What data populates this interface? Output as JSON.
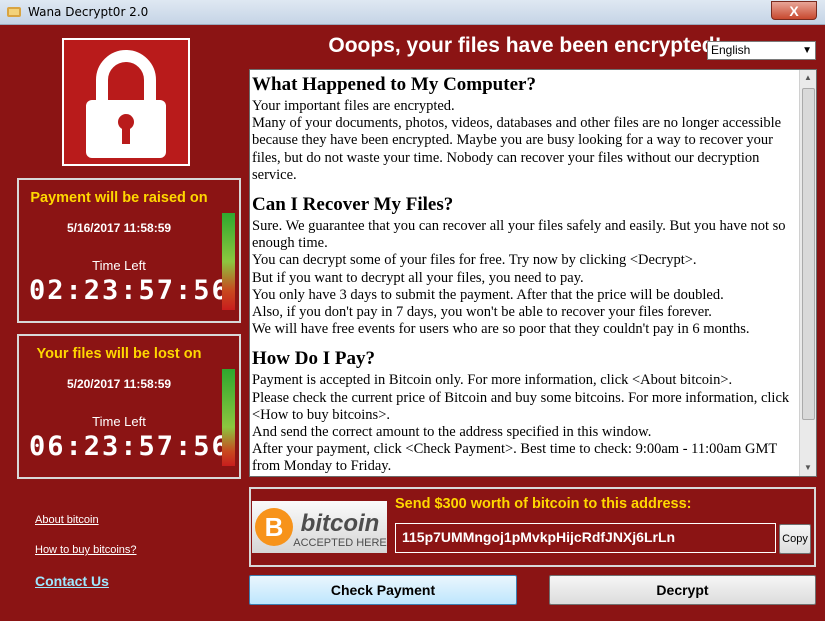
{
  "window": {
    "title": "Wana Decrypt0r 2.0",
    "close_label": "X"
  },
  "header": {
    "title": "Ooops, your files have been encrypted!"
  },
  "language": {
    "selected": "English"
  },
  "timers": {
    "raise": {
      "title": "Payment will be raised on",
      "date": "5/16/2017 11:58:59",
      "label": "Time Left",
      "countdown": "02:23:57:56"
    },
    "lost": {
      "title": "Your files will be lost on",
      "date": "5/20/2017 11:58:59",
      "label": "Time Left",
      "countdown": "06:23:57:56"
    }
  },
  "links": {
    "about_bitcoin": "About bitcoin",
    "how_to_buy": "How to buy bitcoins?",
    "contact": "Contact Us"
  },
  "content": {
    "s1_title": "What Happened to My Computer?",
    "s1_p1": "Your important files are encrypted.",
    "s1_p2": "Many of your documents, photos, videos, databases and other files are no longer accessible because they have been encrypted. Maybe you are busy looking for a way to recover your files, but do not waste your time. Nobody can recover your files without our decryption service.",
    "s2_title": "Can I Recover My Files?",
    "s2_p1": "Sure. We guarantee that you can recover all your files safely and easily. But you have not so enough time.",
    "s2_p2": "You can decrypt some of your files for free. Try now by clicking <Decrypt>.",
    "s2_p3": "But if you want to decrypt all your files, you need to pay.",
    "s2_p4": "You only have 3 days to submit the payment. After that the price will be doubled.",
    "s2_p5": "Also, if you don't pay in 7 days, you won't be able to recover your files forever.",
    "s2_p6": "We will have free events for users who are so poor that they couldn't pay in 6 months.",
    "s3_title": "How Do I Pay?",
    "s3_p1": "Payment is accepted in Bitcoin only. For more information, click <About bitcoin>.",
    "s3_p2": "Please check the current price of Bitcoin and buy some bitcoins. For more information, click <How to buy bitcoins>.",
    "s3_p3": "And send the correct amount to the address specified in this window.",
    "s3_p4": "After your payment, click <Check Payment>. Best time to check: 9:00am - 11:00am GMT from Monday to Friday."
  },
  "payment": {
    "send_text": "Send $300 worth of bitcoin to this address:",
    "address": "115p7UMMngoj1pMvkpHijcRdfJNXj6LrLn",
    "copy_label": "Copy",
    "logo_word": "bitcoin",
    "logo_sub": "ACCEPTED HERE"
  },
  "buttons": {
    "check_payment": "Check Payment",
    "decrypt": "Decrypt"
  },
  "colors": {
    "background": "#8b1414",
    "accent_yellow": "#ffd700",
    "link_cyan": "#9ee8ff"
  }
}
